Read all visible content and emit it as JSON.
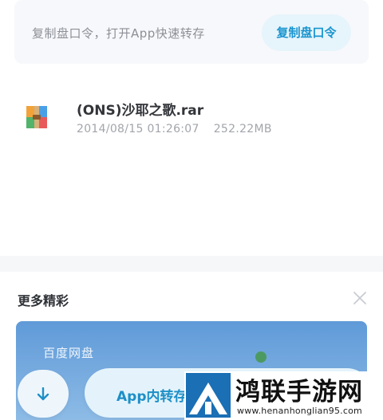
{
  "banner": {
    "hint_text": "复制盘口令，打开App快速转存",
    "copy_button_label": "复制盘口令"
  },
  "file": {
    "icon": "archive-file-icon",
    "name": "(ONS)沙耶之歌.rar",
    "date": "2014/08/15 01:26:07",
    "size": "252.22MB"
  },
  "more": {
    "title": "更多精彩",
    "close_icon": "close-icon"
  },
  "promo": {
    "title": "百度网盘"
  },
  "bottom": {
    "download_icon": "download-arrow-icon",
    "save_in_app_label": "App内转存"
  },
  "watermark": {
    "title": "鸿联手游网",
    "url": "www.henanhonglian95.com"
  },
  "colors": {
    "accent": "#1a95cf",
    "accent_bg": "#e6f4fb",
    "promo_gradient_top": "#5f9ad8",
    "promo_gradient_bottom": "#8dbbe6"
  }
}
